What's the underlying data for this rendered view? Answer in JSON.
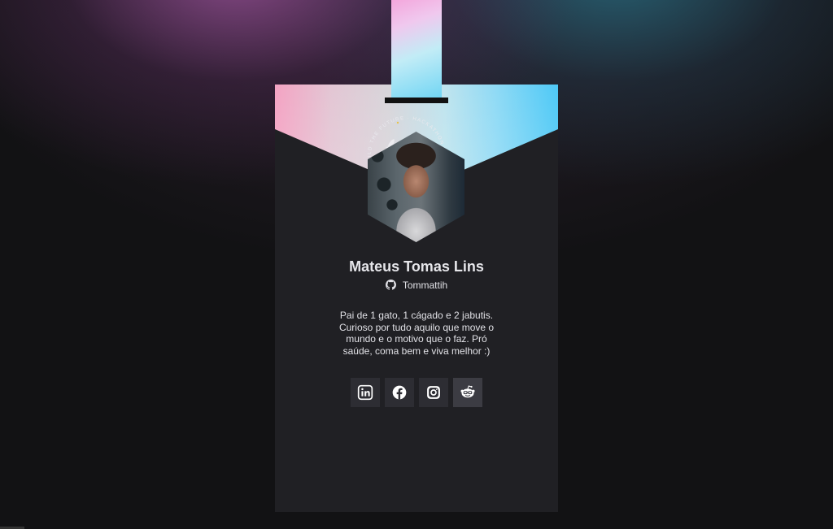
{
  "profile": {
    "name": "Mateus Tomas Lins",
    "github_username": "Tommattih",
    "bio": "Pai de 1 gato, 1 cágado e 2 jabutis. Curioso por tudo aquilo que move o mundo e o motivo que o faz. Pró saúde, coma bem e viva melhor :)",
    "avatar_ring_text": "BUILD THE FUTURE · HACKATHON ·"
  },
  "socials": [
    {
      "name": "linkedin",
      "icon": "linkedin-icon"
    },
    {
      "name": "facebook",
      "icon": "facebook-icon"
    },
    {
      "name": "instagram",
      "icon": "instagram-icon"
    },
    {
      "name": "reddit",
      "icon": "reddit-icon"
    }
  ],
  "colors": {
    "background": "#121214",
    "card": "#202024",
    "social_button": "#2d2d33",
    "strap_pink": "#f4a6dc",
    "strap_cyan": "#6fd5f4",
    "text": "#e1e1e6"
  }
}
